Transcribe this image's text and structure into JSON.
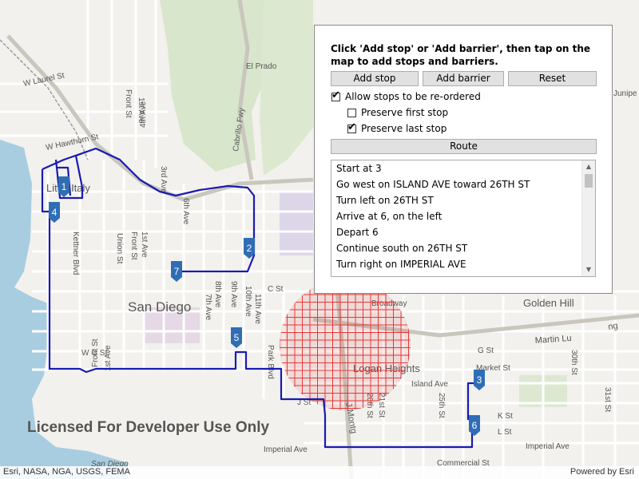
{
  "panel": {
    "instructions": "Click 'Add stop' or 'Add barrier', then tap on the map to add stops and barriers.",
    "add_stop_label": "Add stop",
    "add_barrier_label": "Add barrier",
    "reset_label": "Reset",
    "allow_reorder_label": "Allow stops to be re-ordered",
    "allow_reorder_checked": true,
    "preserve_first_label": "Preserve first stop",
    "preserve_first_checked": false,
    "preserve_last_label": "Preserve last stop",
    "preserve_last_checked": true,
    "route_label": "Route",
    "directions": [
      "Start at 3",
      "Go west on ISLAND AVE toward 26TH ST",
      "Turn left on 26TH ST",
      "Arrive at 6, on the left",
      "Depart 6",
      "Continue south on 26TH ST",
      "Turn right on IMPERIAL AVE"
    ]
  },
  "map": {
    "watermark": "Licensed For Developer Use Only",
    "attribution": "Esri, NASA, NGA, USGS, FEMA",
    "powered_by": "Powered by Esri",
    "route_color": "#1a1ab4",
    "barrier_color": "#e23b3b",
    "stop_color": "#2f6db5",
    "stops": [
      "1",
      "2",
      "3",
      "4",
      "5",
      "6",
      "7"
    ],
    "place_labels": {
      "san_diego": "San Diego",
      "little_italy": "Little Italy",
      "golden_hill": "Golden Hill",
      "logan_heights": "Logan Heights",
      "el_prado": "El Prado",
      "san_diego_bay": "San Diego"
    },
    "street_labels": {
      "laurel": "W Laurel St",
      "hawthorn": "W Hawthorn St",
      "g_st": "W G St",
      "c_st": "C St",
      "broadway": "Broadway",
      "martin_luther": "Martin Lu",
      "g_st_e": "G St",
      "market": "Market St",
      "island": "Island Ave",
      "j_st": "J St",
      "k_st": "K St",
      "l_st": "L St",
      "imperial": "Imperial Ave",
      "imperial_e": "Imperial Ave",
      "commercial": "Commercial St",
      "kettner": "Kettner Blvd",
      "union": "Union St",
      "front": "Front St",
      "first": "1st Ave",
      "fourth": "4th Ave",
      "third": "3rd Ave",
      "sixth": "6th Ave",
      "seventh": "7th Ave",
      "eighth": "8th Ave",
      "ninth": "9th Ave",
      "tenth": "10th Ave",
      "eleventh": "11th Ave",
      "park": "Park Blvd",
      "cabrillo": "Cabrillo Fwy",
      "twentyfirst": "21st St",
      "twentyfifth": "25th St",
      "twentieth": "20th St",
      "thirtieth": "30th St",
      "thirtyfirst": "31st St",
      "front_s": "Front St",
      "first_s": "1st Ave",
      "j_montg": "J Montg",
      "ng": "ng",
      "juniper": "Junipe"
    }
  }
}
